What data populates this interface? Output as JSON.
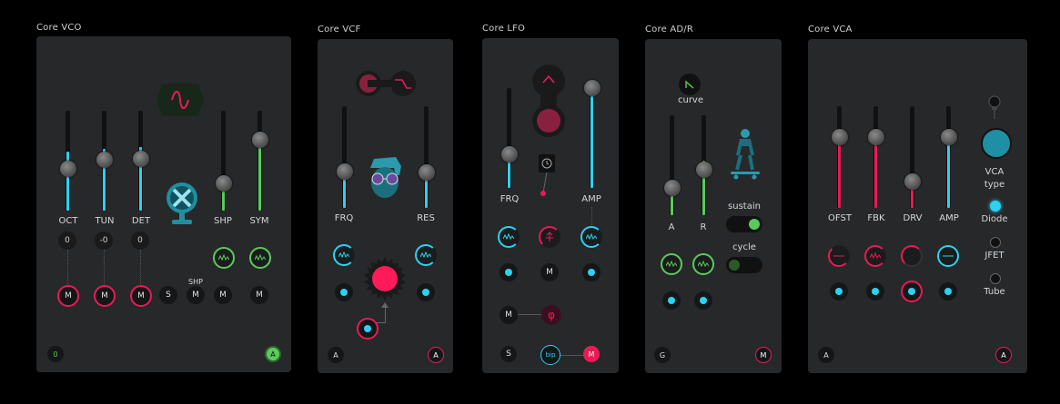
{
  "colors": {
    "accent_blue": "#2bd2f2",
    "accent_red": "#ea1a57",
    "accent_green": "#5acb5a",
    "panel": "#27282a"
  },
  "vco": {
    "title": "Core VCO",
    "sliders": [
      {
        "label": "OCT",
        "value": "0",
        "level": 0.6
      },
      {
        "label": "TUN",
        "value": "-0",
        "level": 0.62
      },
      {
        "label": "DET",
        "value": "0",
        "level": 0.63
      }
    ],
    "shape_sliders": [
      {
        "label": "SHP",
        "level": 0.35
      },
      {
        "label": "SYM",
        "level": 0.75
      }
    ],
    "buttons": {
      "s": "S",
      "m": "M",
      "shp_small": "SHP"
    },
    "footer_left": "0",
    "footer_right": "A"
  },
  "vcf": {
    "title": "Core VCF",
    "sliders": [
      {
        "label": "FRQ",
        "level": 0.5
      },
      {
        "label": "RES",
        "level": 0.4
      }
    ],
    "footer_left": "A",
    "footer_right": "A"
  },
  "lfo": {
    "title": "Core LFO",
    "sliders": [
      {
        "label": "FRQ",
        "level": 0.4
      },
      {
        "label": "AMP",
        "level": 0.95
      }
    ],
    "buttons": {
      "m": "M",
      "phi": "φ",
      "s": "S",
      "bip": "bip",
      "m_right": "M"
    }
  },
  "adr": {
    "title": "Core AD/R",
    "curve_label": "curve",
    "sliders": [
      {
        "label": "A",
        "level": 0.3
      },
      {
        "label": "R",
        "level": 0.55
      }
    ],
    "sustain_label": "sustain",
    "cycle_label": "cycle",
    "sustain_on": true,
    "cycle_on": false,
    "footer_left": "G",
    "footer_right": "M"
  },
  "vca": {
    "title": "Core VCA",
    "sliders": [
      {
        "label": "OFST",
        "level": 0.85
      },
      {
        "label": "FBK",
        "level": 0.85
      },
      {
        "label": "DRV",
        "level": 0.25
      },
      {
        "label": "AMP",
        "level": 0.85
      }
    ],
    "type_label_1": "VCA",
    "type_label_2": "type",
    "types": [
      "Diode",
      "JFET",
      "Tube"
    ],
    "selected_type": "Diode",
    "footer_left": "A",
    "footer_right": "A"
  }
}
